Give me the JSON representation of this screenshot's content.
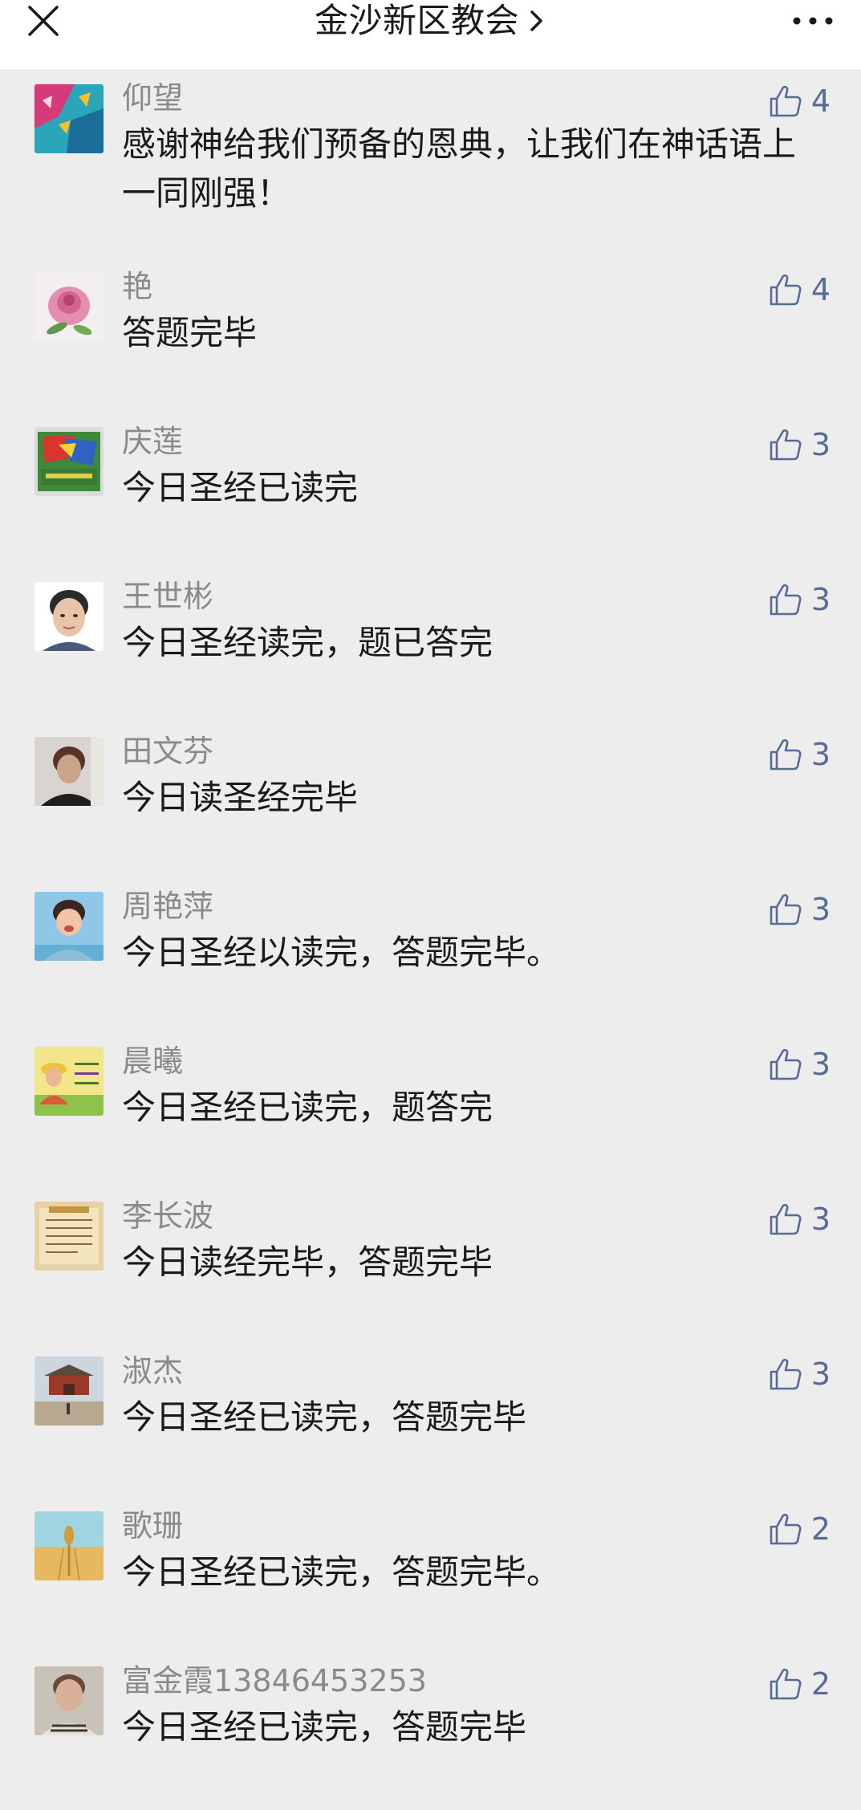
{
  "header": {
    "title": "金沙新区教会"
  },
  "comments": [
    {
      "author": "仰望",
      "text": "感谢神给我们预备的恩典，让我们在神话语上一同刚强！",
      "likes": "4",
      "avatar": "avatar-1"
    },
    {
      "author": "艳",
      "text": "答题完毕",
      "likes": "4",
      "avatar": "avatar-rose"
    },
    {
      "author": "庆莲",
      "text": "今日圣经已读完",
      "likes": "3",
      "avatar": "avatar-card"
    },
    {
      "author": "王世彬",
      "text": "今日圣经读完，题已答完",
      "likes": "3",
      "avatar": "avatar-portrait"
    },
    {
      "author": "田文芬",
      "text": "今日读圣经完毕",
      "likes": "3",
      "avatar": "avatar-portrait-dark"
    },
    {
      "author": "周艳萍",
      "text": "今日圣经以读完，答题完毕。",
      "likes": "3",
      "avatar": "avatar-child"
    },
    {
      "author": "晨曦",
      "text": "今日圣经已读完，题答完",
      "likes": "3",
      "avatar": "avatar-yellow"
    },
    {
      "author": "李长波",
      "text": "今日读经完毕，答题完毕",
      "likes": "3",
      "avatar": "avatar-scroll"
    },
    {
      "author": "淑杰",
      "text": "今日圣经已读完，答题完毕",
      "likes": "3",
      "avatar": "avatar-palace"
    },
    {
      "author": "歌珊",
      "text": "今日圣经已读完，答题完毕。",
      "likes": "2",
      "avatar": "avatar-wheat"
    },
    {
      "author": "富金霞13846453253",
      "text": "今日圣经已读完，答题完毕",
      "likes": "2",
      "avatar": "avatar-portrait-2"
    }
  ]
}
